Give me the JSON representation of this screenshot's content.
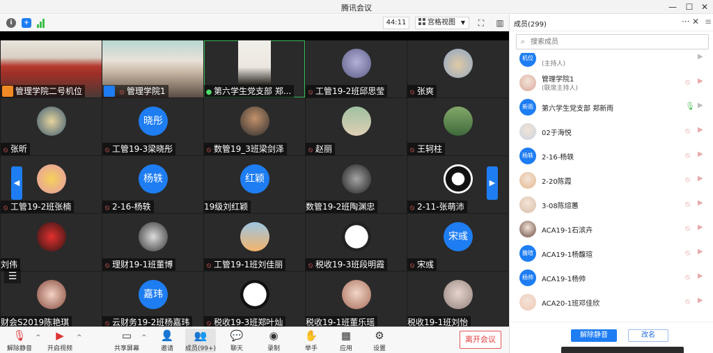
{
  "window": {
    "title": "腾讯会议"
  },
  "meeting_bar": {
    "timer": "44:11",
    "view_mode": "宫格视图"
  },
  "grid": {
    "tiles": [
      {
        "name": "管理学院二号机位",
        "status": "host",
        "kind": "photo-classroom"
      },
      {
        "name": "管理学院1",
        "status": "host-muted",
        "kind": "photo-classroom2"
      },
      {
        "name": "第六学生党支部 郑...",
        "status": "on",
        "kind": "photo-woman"
      },
      {
        "name": "工管19-2班邱思莹",
        "status": "muted",
        "kind": "anime"
      },
      {
        "name": "张爽",
        "status": "muted",
        "kind": "cat"
      },
      {
        "name": "张昕",
        "status": "muted",
        "kind": "moon"
      },
      {
        "name": "工管19-3梁晓彤",
        "status": "muted",
        "kind": "text",
        "avatar": "晓彤"
      },
      {
        "name": "数管19_3班梁剑泽",
        "status": "muted",
        "kind": "man"
      },
      {
        "name": "赵丽",
        "status": "muted",
        "kind": "group"
      },
      {
        "name": "王轲柱",
        "status": "muted",
        "kind": "tree"
      },
      {
        "name": "工管19-2班张楠",
        "status": "muted",
        "kind": "sailor"
      },
      {
        "name": "2-16-杨轶",
        "status": "muted",
        "kind": "text",
        "avatar": "杨轶"
      },
      {
        "name": "19级刘红颖",
        "status": "none",
        "kind": "text",
        "avatar": "红颖"
      },
      {
        "name": "数管19-2班陶渊忠",
        "status": "none",
        "kind": "dark"
      },
      {
        "name": "2-11-张萌沛",
        "status": "muted",
        "kind": "bw-cat"
      },
      {
        "name": "刘伟",
        "status": "none",
        "kind": "red-cup"
      },
      {
        "name": "理财19-1班董博",
        "status": "muted",
        "kind": "bw-kid"
      },
      {
        "name": "工管19-1班刘佳丽",
        "status": "muted",
        "kind": "sunset"
      },
      {
        "name": "税收19-3班段明霞",
        "status": "muted",
        "kind": "cartoon-face"
      },
      {
        "name": "宋彧",
        "status": "muted",
        "kind": "text",
        "avatar": "宋彧"
      },
      {
        "name": "财会S2019陈艳琪",
        "status": "none",
        "kind": "girl-doll"
      },
      {
        "name": "云财务19-2班杨嘉玮",
        "status": "muted",
        "kind": "text",
        "avatar": "嘉玮"
      },
      {
        "name": "税收19-3班郑叶灿",
        "status": "muted",
        "kind": "cartoon-face2"
      },
      {
        "name": "税收19-1班董乐瑶",
        "status": "none",
        "kind": "girl"
      },
      {
        "name": "税收19-1班刘怡",
        "status": "none",
        "kind": "girl2"
      }
    ]
  },
  "toolbar": {
    "mute_label": "解除静音",
    "video_label": "开启视频",
    "share_label": "共享屏幕",
    "invite_label": "邀请",
    "members_label": "成员(99+)",
    "chat_label": "聊天",
    "record_label": "录制",
    "raise_label": "举手",
    "apps_label": "应用",
    "settings_label": "设置",
    "leave_label": "离开会议"
  },
  "panel": {
    "title": "成员(299)",
    "search_placeholder": "搜索成员",
    "members": [
      {
        "name": "",
        "sub": "(主持人)",
        "avatar": "机位",
        "avatar_kind": "text",
        "mic": "none",
        "cam": "on"
      },
      {
        "name": "管理学院1",
        "sub": "(联席主持人)",
        "avatar": "",
        "avatar_kind": "photo",
        "mic": "muted",
        "cam": "off"
      },
      {
        "name": "第六学生党支部 郑新雨",
        "sub": "",
        "avatar": "新雨",
        "avatar_kind": "text",
        "mic": "on",
        "cam": "on"
      },
      {
        "name": "02于海悦",
        "sub": "",
        "avatar": "",
        "avatar_kind": "photo",
        "mic": "muted",
        "cam": "off"
      },
      {
        "name": "2-16-杨轶",
        "sub": "",
        "avatar": "杨轶",
        "avatar_kind": "text",
        "mic": "muted",
        "cam": "off"
      },
      {
        "name": "2-20陈霞",
        "sub": "",
        "avatar": "",
        "avatar_kind": "photo",
        "mic": "muted",
        "cam": "off"
      },
      {
        "name": "3-08陈煊蕙",
        "sub": "",
        "avatar": "",
        "avatar_kind": "photo",
        "mic": "muted",
        "cam": "off"
      },
      {
        "name": "ACA19-1石滨卉",
        "sub": "",
        "avatar": "",
        "avatar_kind": "photo",
        "mic": "muted",
        "cam": "off"
      },
      {
        "name": "ACA19-1杨馥瑄",
        "sub": "",
        "avatar": "馥瑄",
        "avatar_kind": "text",
        "mic": "muted",
        "cam": "off"
      },
      {
        "name": "ACA19-1杨帅",
        "sub": "",
        "avatar": "杨帅",
        "avatar_kind": "text",
        "mic": "muted",
        "cam": "off"
      },
      {
        "name": "ACA20-1班邓佳欣",
        "sub": "",
        "avatar": "",
        "avatar_kind": "photo",
        "mic": "muted",
        "cam": "off"
      }
    ],
    "unmute_all_label": "解除静音",
    "rename_label": "改名"
  },
  "colors": {
    "accent": "#1e7df2",
    "danger": "#e03c3c",
    "speaking": "#3bbf5a"
  }
}
